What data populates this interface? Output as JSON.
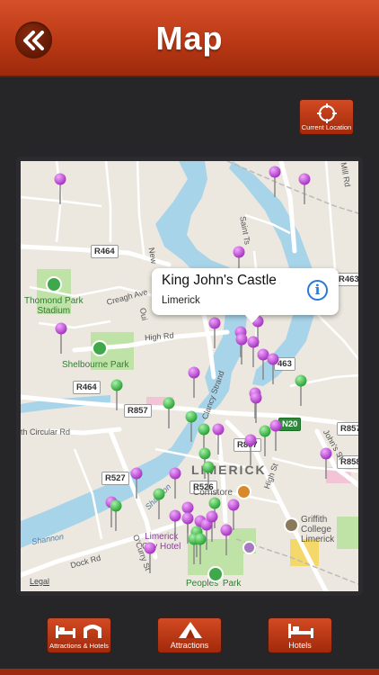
{
  "header": {
    "title": "Map",
    "back_icon": "double-chevron-left-icon"
  },
  "current_location": {
    "label": "Current Location",
    "icon": "crosshair-icon"
  },
  "callout": {
    "title": "King John's Castle",
    "subtitle": "Limerick",
    "icon": "info-icon"
  },
  "roads": {
    "r464_top": "R464",
    "r463_right": "R463",
    "r463_mid": "463",
    "r464_left": "R464",
    "r857_left": "R857",
    "r857_mid": "R857",
    "r857_right": "R857",
    "r858": "R858",
    "r527": "R527",
    "r526": "R526",
    "n20": "N20"
  },
  "places": {
    "thomond": "Thomond Park\nStadium",
    "shelbourne": "Shelbourne Park",
    "limerick": "LIMERICK",
    "cornstore": "Cornstore",
    "griffith": "Griffith College\nLimerick",
    "city_hotel": "Limerick\nCity Hotel",
    "peoples_park": "Peoples' Park",
    "shannon_1": "Shannon",
    "shannon_2": "Shannon",
    "legal": "Legal"
  },
  "streets": {
    "creagh": "Creagh Ave",
    "high_rd": "High Rd",
    "circular": "th Circular Rd",
    "dock": "Dock Rd",
    "ocurry": "O'Curry St",
    "mill": "Mill Rd",
    "saint_ts": "Saint Ts",
    "clancy": "Clancy Strand",
    "johns": "John's St",
    "high_st": "High St",
    "new": "New",
    "oui": "Oui"
  },
  "bottom_tabs": [
    {
      "label": "Attractions & Hotels",
      "icon": "bed-and-arch-icon"
    },
    {
      "label": "Attractions",
      "icon": "tent-icon"
    },
    {
      "label": "Hotels",
      "icon": "bed-icon"
    }
  ],
  "colors": {
    "accent": "#b73714",
    "water": "#a8d4ea",
    "pin_purple": "#c257d6",
    "pin_green": "#3fbf4a"
  }
}
